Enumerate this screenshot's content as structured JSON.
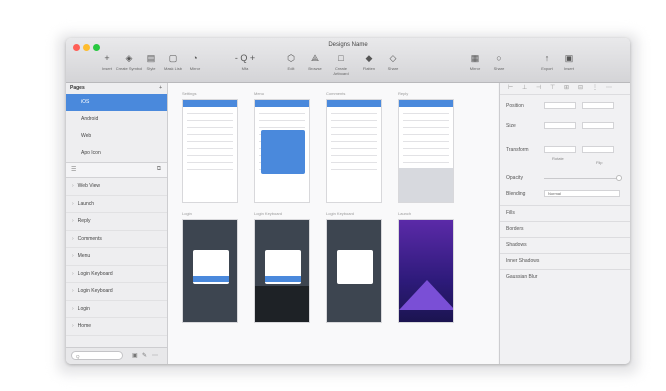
{
  "window": {
    "title": "Designs Name"
  },
  "traffic_lights": {
    "close": "#ff5f57",
    "minimize": "#febc2e",
    "zoom": "#28c840"
  },
  "toolbar": [
    {
      "label": "Insert",
      "icon": "plus-icon",
      "glyph": "+"
    },
    {
      "label": "Create Symbol",
      "icon": "symbol-icon",
      "glyph": "◈"
    },
    {
      "label": "Style",
      "icon": "style-icon",
      "glyph": "▤"
    },
    {
      "label": "Mask Lisb",
      "icon": "mask-icon",
      "glyph": "▢"
    },
    {
      "label": "Mirror",
      "icon": "mirror-icon",
      "glyph": "◔"
    },
    {
      "label": "Mfa",
      "icon": "zoom-icon",
      "glyph": "-  Q  +"
    },
    {
      "label": "Edit",
      "icon": "edit-icon",
      "glyph": "⬡"
    },
    {
      "label": "Browse",
      "icon": "browse-icon",
      "glyph": "⟁"
    },
    {
      "label": "Create Artboard",
      "icon": "artboard-icon",
      "glyph": "□"
    },
    {
      "label": "Flatten",
      "icon": "flatten-icon",
      "glyph": "◆"
    },
    {
      "label": "Share",
      "icon": "share-icon",
      "glyph": "◇"
    },
    {
      "label": "Mirror",
      "icon": "mirror2-icon",
      "glyph": "▦"
    },
    {
      "label": "Share",
      "icon": "cloud-icon",
      "glyph": "○"
    },
    {
      "label": "Export",
      "icon": "export-icon",
      "glyph": "↑"
    },
    {
      "label": "Insert",
      "icon": "insert-icon",
      "glyph": "▣"
    }
  ],
  "sidebar": {
    "pages_header": "Pages",
    "pages": [
      "iOS",
      "Android",
      "Web",
      "Apo Icon"
    ],
    "layers": [
      "Web View",
      "Launch",
      "Reply",
      "Comments",
      "Menu",
      "Login Keyboard",
      "Login Keyboard",
      "Login",
      "Home"
    ],
    "search_placeholder": "Q"
  },
  "canvas": {
    "artboards_top": [
      "Settings",
      "Menu",
      "Comments",
      "Reply"
    ],
    "artboards_bottom": [
      "Login",
      "Login Keyboard",
      "Login Keyboard",
      "Launch"
    ]
  },
  "inspector": {
    "position": "Position",
    "size": "Size",
    "transform": "Transform",
    "rotate": "Rotate",
    "flip": "Flip",
    "opacity": "Opacity",
    "blending": "Blending",
    "blending_value": "Normal",
    "sections": [
      "Fills",
      "Borders",
      "Shadows",
      "Inner Shadows",
      "Gaussian Blur"
    ]
  }
}
